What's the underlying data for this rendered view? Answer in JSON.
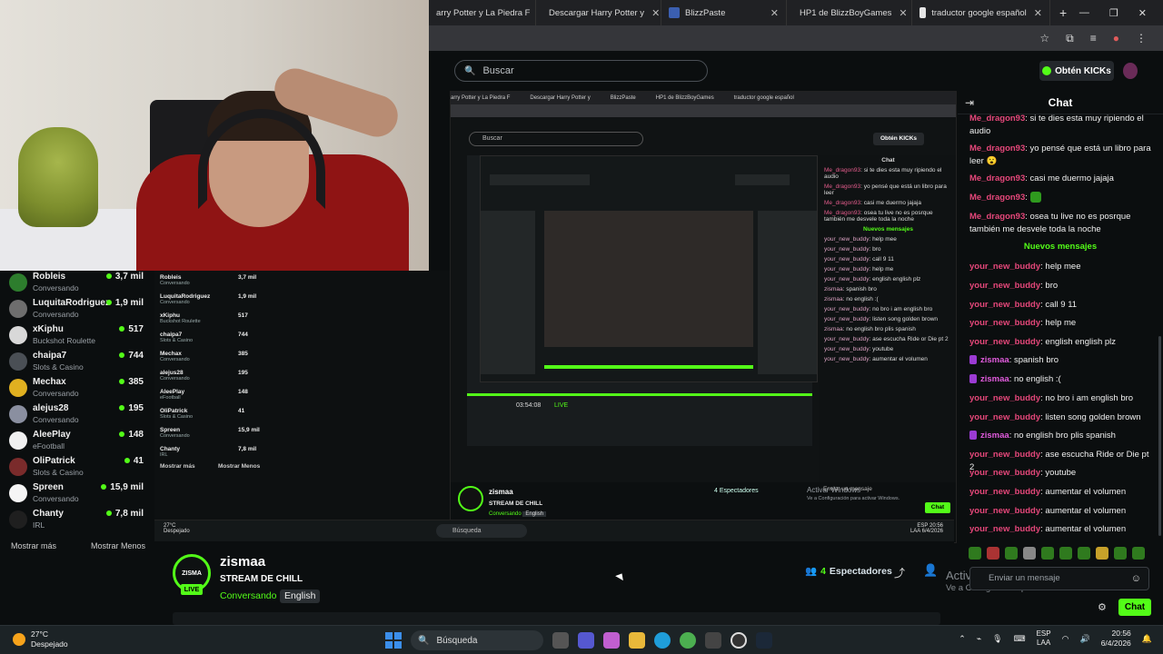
{
  "browser": {
    "tabs": [
      {
        "title": "arry Potter y La Piedra F",
        "color": "#444"
      },
      {
        "title": "Descargar Harry Potter y",
        "color": "#4a78b8"
      },
      {
        "title": "BlizzPaste",
        "color": "#3b5fb0"
      },
      {
        "title": "HP1 de BlizzBoyGames",
        "color": "#3b8eea"
      },
      {
        "title": "traductor google español",
        "color": "#e5e5e5"
      }
    ],
    "new_tab": "+"
  },
  "header": {
    "search_placeholder": "Buscar",
    "get_kicks": "Obtén KICKs"
  },
  "sidebar": {
    "items": [
      {
        "name": "Robleis",
        "category": "Conversando",
        "count": "3,7 mil"
      },
      {
        "name": "LuquitaRodriguez",
        "category": "Conversando",
        "count": "1,9 mil"
      },
      {
        "name": "xKiphu",
        "category": "Buckshot Roulette",
        "count": "517"
      },
      {
        "name": "chaipa7",
        "category": "Slots & Casino",
        "count": "744"
      },
      {
        "name": "Mechax",
        "category": "Conversando",
        "count": "385"
      },
      {
        "name": "alejus28",
        "category": "Conversando",
        "count": "195"
      },
      {
        "name": "AleePlay",
        "category": "eFootball",
        "count": "148"
      },
      {
        "name": "OliPatrick",
        "category": "Slots & Casino",
        "count": "41"
      },
      {
        "name": "Spreen",
        "category": "Conversando",
        "count": "15,9 mil"
      },
      {
        "name": "Chanty",
        "category": "IRL",
        "count": "7,8 mil"
      }
    ],
    "show_more": "Mostrar más",
    "show_less": "Mostrar Menos"
  },
  "nested": {
    "tabs": [
      "arry Potter y La Piedra F",
      "Descargar Harry Potter y",
      "BlizzPaste",
      "HP1 de BlizzBoyGames",
      "traductor google español"
    ],
    "search": "Buscar",
    "get_kicks": "Obtén KICKs",
    "chat_title": "Chat",
    "chat_lines": [
      {
        "user": "Me_dragon93",
        "text": "si te dies esta muy ripiendo el audio"
      },
      {
        "user": "Me_dragon93",
        "text": "yo pensé que está un libro para leer"
      },
      {
        "user": "Me_dragon93",
        "text": "casi me duermo jajaja"
      },
      {
        "user": "Me_dragon93",
        "text": "osea tu live no es posrque también me desvele toda la noche"
      },
      {
        "user": "your_new_buddy",
        "text": "help mee"
      },
      {
        "user": "your_new_buddy",
        "text": "bro"
      },
      {
        "user": "your_new_buddy",
        "text": "call 9 11"
      },
      {
        "user": "your_new_buddy",
        "text": "help me"
      },
      {
        "user": "your_new_buddy",
        "text": "english english plz"
      },
      {
        "user": "zismaa",
        "text": "spanish bro"
      },
      {
        "user": "zismaa",
        "text": "no english :("
      },
      {
        "user": "your_new_buddy",
        "text": "no bro i am english bro"
      },
      {
        "user": "your_new_buddy",
        "text": "listen song golden brown"
      },
      {
        "user": "zismaa",
        "text": "no english bro plis spanish"
      },
      {
        "user": "your_new_buddy",
        "text": "ase escucha Ride or Die pt 2"
      },
      {
        "user": "your_new_buddy",
        "text": "youtube"
      },
      {
        "user": "your_new_buddy",
        "text": "aumentar el volumen"
      }
    ],
    "new_messages": "Nuevos mensajes",
    "streamer": "zismaa",
    "title": "STREAM DE CHILL",
    "category": "Conversando",
    "tag": "English",
    "viewers": "4 Espectadores",
    "time": "03:54:08",
    "live": "LIVE",
    "chat_placeholder": "Enviar un mensaje",
    "chat_button": "Chat",
    "activate1": "Activar Windows",
    "activate2": "Ve a Configuración para activar Windows.",
    "weather_temp": "27°C",
    "weather_desc": "Despejado",
    "taskbar_search": "Búsqueda",
    "lang1": "ESP",
    "lang2": "LAA",
    "clock_time": "20:56",
    "clock_date": "6/4/2026"
  },
  "stream": {
    "streamer": "zismaa",
    "title": "STREAM DE CHILL",
    "category": "Conversando",
    "tag": "English",
    "viewers_num": "4",
    "viewers_label": "Espectadores",
    "live": "LIVE",
    "logo_text": "ZISMA"
  },
  "chat": {
    "title": "Chat",
    "new_messages": "Nuevos mensajes",
    "messages": [
      {
        "user": "Me_dragon93",
        "text": "si te dies esta muy ripiendo el audio",
        "badge": false
      },
      {
        "user": "Me_dragon93",
        "text": "yo pensé que está un libro para leer 😮",
        "badge": false
      },
      {
        "user": "Me_dragon93",
        "text": "casi me duermo jajaja",
        "badge": false
      },
      {
        "user": "Me_dragon93",
        "text": "",
        "badge": false
      },
      {
        "user": "Me_dragon93",
        "text": "osea tu live no es posrque también me desvele toda la noche",
        "badge": false
      },
      {
        "user": "your_new_buddy",
        "text": "help mee",
        "badge": false
      },
      {
        "user": "your_new_buddy",
        "text": "bro",
        "badge": false
      },
      {
        "user": "your_new_buddy",
        "text": "call 9 11",
        "badge": false
      },
      {
        "user": "your_new_buddy",
        "text": "help me",
        "badge": false
      },
      {
        "user": "your_new_buddy",
        "text": "english english plz",
        "badge": false
      },
      {
        "user": "zismaa",
        "text": "spanish bro",
        "badge": true
      },
      {
        "user": "zismaa",
        "text": "no english :(",
        "badge": true
      },
      {
        "user": "your_new_buddy",
        "text": "no bro i am english bro",
        "badge": false
      },
      {
        "user": "your_new_buddy",
        "text": "listen song golden brown",
        "badge": false
      },
      {
        "user": "zismaa",
        "text": "no english bro plis spanish",
        "badge": true
      },
      {
        "user": "your_new_buddy",
        "text": "ase escucha Ride or Die pt 2",
        "badge": false
      },
      {
        "user": "your_new_buddy",
        "text": "youtube",
        "badge": false
      },
      {
        "user": "your_new_buddy",
        "text": "aumentar el volumen",
        "badge": false
      },
      {
        "user": "your_new_buddy",
        "text": "aumentar el volumen",
        "badge": false
      },
      {
        "user": "your_new_buddy",
        "text": "aumentar el volumen",
        "badge": false
      }
    ],
    "input_placeholder": "Enviar un mensaje",
    "send_label": "Chat",
    "activate_title": "Activar Windows",
    "activate_sub": "Ve a Configuración para activar Windows."
  },
  "taskbar": {
    "weather_temp": "27°C",
    "weather_desc": "Despejado",
    "search": "Búsqueda",
    "lang1": "ESP",
    "lang2": "LAA",
    "time": "20:56",
    "date": "6/4/2026"
  },
  "colors": {
    "accent": "#53fc18",
    "username": "#e5477a",
    "background": "#0b0e0f"
  }
}
